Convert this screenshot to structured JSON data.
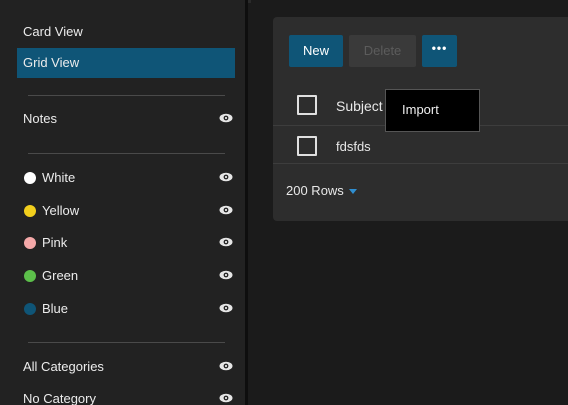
{
  "sidebar": {
    "views": [
      {
        "label": "Card View",
        "active": false
      },
      {
        "label": "Grid View",
        "active": true
      }
    ],
    "notes": {
      "label": "Notes",
      "icon": "eye-icon"
    },
    "colors": [
      {
        "label": "White",
        "color": "#ffffff",
        "icon": "eye-icon"
      },
      {
        "label": "Yellow",
        "color": "#f2cf1d",
        "icon": "eye-icon"
      },
      {
        "label": "Pink",
        "color": "#f5a9a9",
        "icon": "eye-icon"
      },
      {
        "label": "Green",
        "color": "#5cbf4a",
        "icon": "eye-icon"
      },
      {
        "label": "Blue",
        "color": "#0f5577",
        "icon": "eye-icon"
      }
    ],
    "categories": [
      {
        "label": "All Categories",
        "icon": "eye-icon"
      },
      {
        "label": "No Category",
        "icon": "eye-icon"
      }
    ]
  },
  "toolbar": {
    "new_label": "New",
    "delete_label": "Delete",
    "more_label": "•••",
    "more_menu": {
      "items": [
        "Import"
      ]
    }
  },
  "grid": {
    "header_label": "Subject",
    "rows": [
      {
        "subject": "fdsfds"
      }
    ],
    "rows_per_page": "200 Rows"
  },
  "colors": {
    "accent": "#0f5577",
    "sidebar_bg": "#222222",
    "card_bg": "#2d2d2d",
    "caret": "#2f8ed0"
  }
}
